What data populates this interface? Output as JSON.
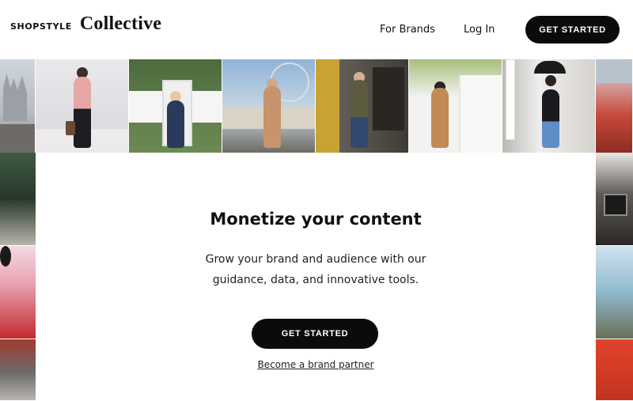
{
  "header": {
    "logo_small": "SHOPSTYLE",
    "logo_large": "Collective",
    "nav": [
      {
        "label": "For Brands"
      },
      {
        "label": "Log In"
      }
    ],
    "cta_label": "GET STARTED"
  },
  "main": {
    "title": "Monetize your content",
    "subtitle": "Grow your brand and audience with our guidance, data, and innovative tools.",
    "cta_label": "GET STARTED",
    "partner_link": "Become a brand partner"
  },
  "colors": {
    "primary": "#0b0b0b",
    "background": "#ffffff",
    "text": "#111111"
  }
}
